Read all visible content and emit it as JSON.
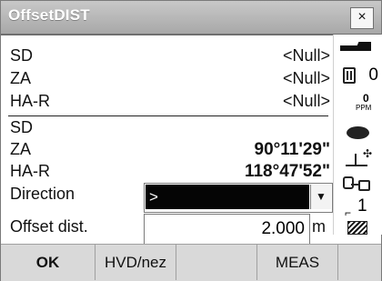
{
  "window": {
    "title": "OffsetDIST",
    "close_label": "×"
  },
  "measurements": {
    "top_rows": [
      {
        "label": "SD",
        "value": "<Null>"
      },
      {
        "label": "ZA",
        "value": "<Null>"
      },
      {
        "label": "HA-R",
        "value": "<Null>"
      }
    ],
    "bottom_rows": [
      {
        "label": "SD",
        "value": ""
      },
      {
        "label": "ZA",
        "value": "90°11'29\""
      },
      {
        "label": "HA-R",
        "value": "118°47'52\""
      }
    ],
    "direction": {
      "label": "Direction",
      "value": ">"
    },
    "offset": {
      "label": "Offset dist.",
      "value": "2.000",
      "unit": "m"
    }
  },
  "status": {
    "prism_value": "0",
    "ppm_value": "0",
    "ppm_label": "PPM",
    "page_number": "1"
  },
  "softkeys": [
    {
      "label": "OK"
    },
    {
      "label": "HVD/nez"
    },
    {
      "label": ""
    },
    {
      "label": "MEAS"
    },
    {
      "label": ""
    }
  ],
  "colors": {
    "title_bar": "#b8b8b8",
    "selection_background": "#050505",
    "softkey_bar": "#d9d9d9"
  },
  "icons": [
    "battery-icon",
    "prism-icon",
    "ppm-icon",
    "sight-icon",
    "target-icon",
    "face-icon",
    "page-icon",
    "shift-icon",
    "dropdown-arrow-icon"
  ]
}
